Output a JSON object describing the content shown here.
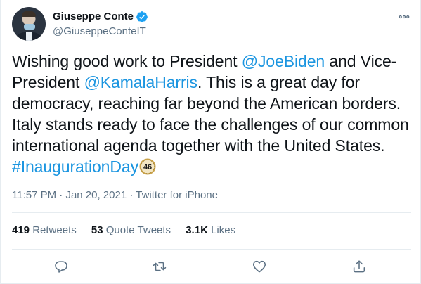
{
  "author": {
    "display_name": "Giuseppe Conte",
    "handle": "@GiuseppeConteIT",
    "verified": true
  },
  "tweet": {
    "line1_pre": "Wishing good work to President ",
    "mention1": "@JoeBiden",
    "line1_post": " and Vice-",
    "line2_pre": "President ",
    "mention2": "@KamalaHarris",
    "line2_post": ". This is a great day for",
    "line3": "democracy, reaching far beyond the American borders.",
    "line4": "Italy stands ready to face the challenges of our common",
    "line5": "international agenda together with the United States.",
    "hashtag": "#InaugurationDay",
    "hashtag_emoji_text": "46"
  },
  "meta": {
    "time": "11:57 PM",
    "sep1": " · ",
    "date": "Jan 20, 2021",
    "sep2": " · ",
    "source": "Twitter for iPhone"
  },
  "stats": {
    "retweets_count": "419",
    "retweets_label": "Retweets",
    "quotes_count": "53",
    "quotes_label": "Quote Tweets",
    "likes_count": "3.1K",
    "likes_label": "Likes"
  },
  "icons": {
    "verified": "verified-badge-icon",
    "more": "more-options-icon",
    "reply": "reply-icon",
    "retweet": "retweet-icon",
    "like": "heart-icon",
    "share": "share-icon"
  },
  "colors": {
    "link": "#1b95e0",
    "verified": "#1da1f2",
    "muted": "#5b7083",
    "text": "#0f1419",
    "divider": "#e6ecf0"
  }
}
